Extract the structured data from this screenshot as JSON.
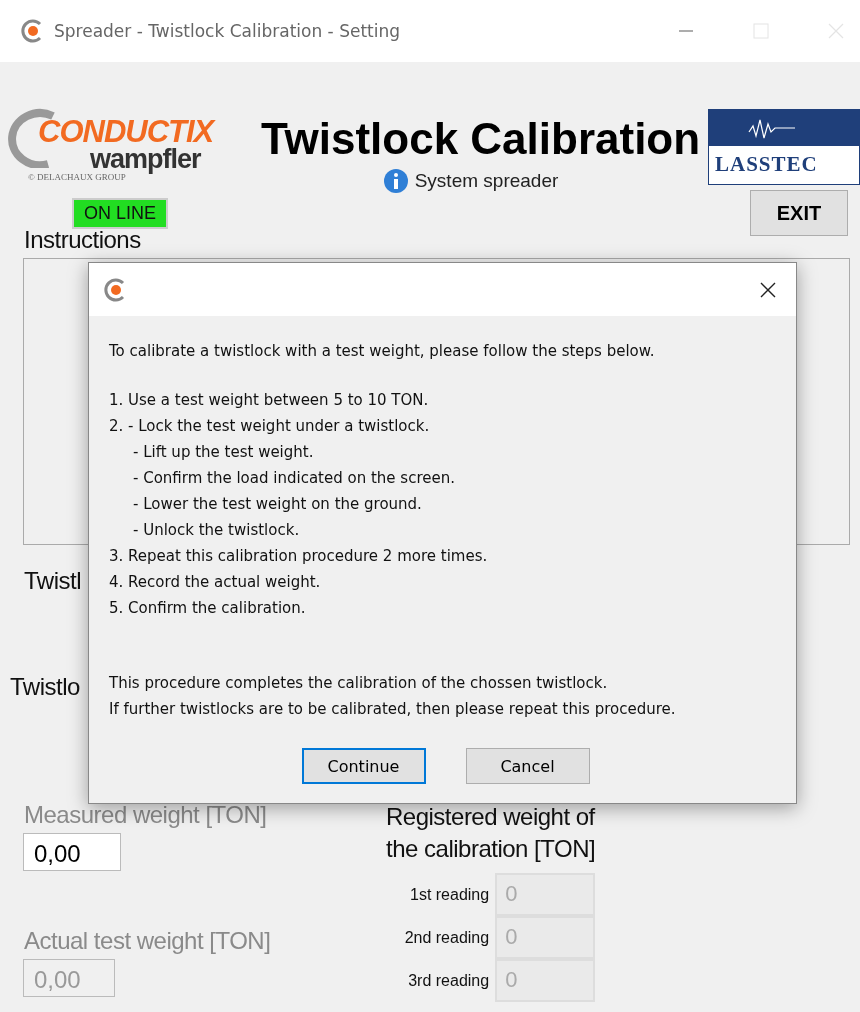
{
  "window": {
    "title": "Spreader - Twistlock Calibration - Setting"
  },
  "header": {
    "brand": "CONDUCTIX",
    "brand_sub": "wampfler",
    "brand_group": "© DELACHAUX GROUP",
    "title": "Twistlock Calibration",
    "partner_logo": "LASSTEC",
    "system": "System spreader",
    "status": {
      "label": "ON LINE",
      "online": true
    },
    "exit": "EXIT"
  },
  "instructions": {
    "label": "Instructions"
  },
  "covered_labels": [
    "Twistl",
    "Twistlo"
  ],
  "measured": {
    "label": "Measured weight [TON]",
    "value": "0,00"
  },
  "registered": {
    "lines": [
      "Registered weight of",
      "the calibration [TON]"
    ],
    "readings": [
      {
        "label": "1st reading",
        "value": "0",
        "disabled": true
      },
      {
        "label": "2nd reading",
        "value": "0",
        "disabled": true
      },
      {
        "label": "3rd reading",
        "value": "0",
        "disabled": true
      }
    ]
  },
  "actual": {
    "label": "Actual test weight [TON]",
    "value": "0,00",
    "disabled": true
  },
  "dialog": {
    "intro": "To calibrate a twistlock with a test weight, please follow the steps below.",
    "steps": [
      {
        "kind": "step",
        "text": "1. Use a test weight between 5 to 10 TON."
      },
      {
        "kind": "step",
        "text": "2.  - Lock the test weight under a twistlock."
      },
      {
        "kind": "sub",
        "text": "- Lift up the test weight."
      },
      {
        "kind": "sub",
        "text": "- Confirm the load indicated on the screen."
      },
      {
        "kind": "sub",
        "text": "- Lower the test weight on the ground."
      },
      {
        "kind": "sub",
        "text": "- Unlock the twistlock."
      },
      {
        "kind": "step",
        "text": "3. Repeat this calibration procedure 2 more times."
      },
      {
        "kind": "step",
        "text": "4. Record the actual weight."
      },
      {
        "kind": "step",
        "text": "5. Confirm the calibration."
      }
    ],
    "outro": [
      "This procedure completes the calibration of the chossen twistlock.",
      "If further twistlocks are to be calibrated, then please repeat this procedure."
    ],
    "buttons": [
      {
        "label": "Continue",
        "focused": true
      },
      {
        "label": "Cancel",
        "focused": false
      }
    ]
  }
}
